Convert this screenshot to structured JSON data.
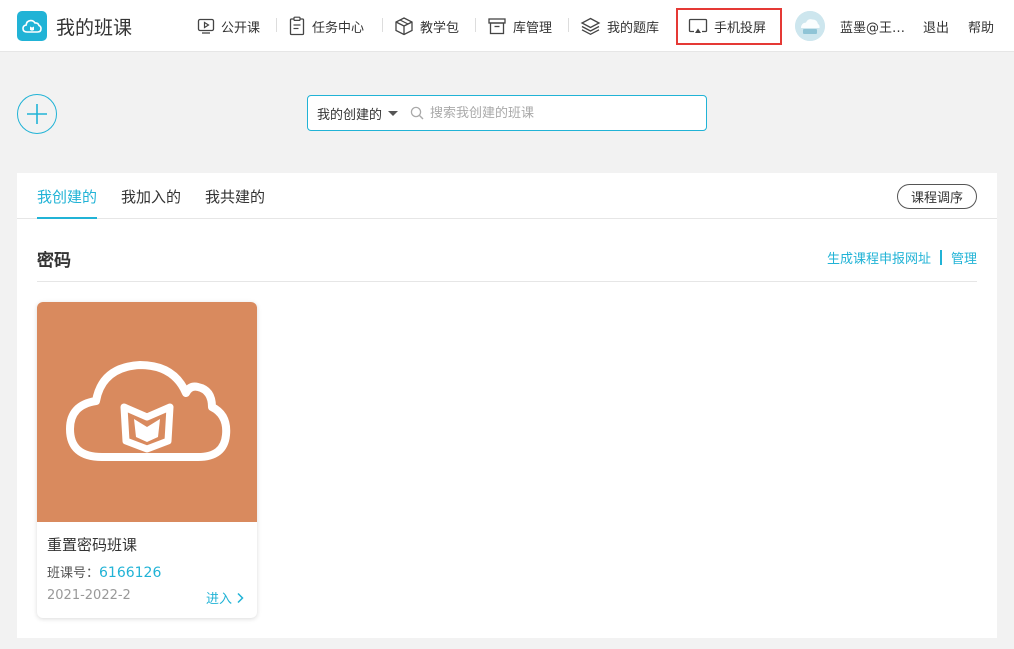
{
  "header": {
    "app_title": "我的班课",
    "nav": [
      {
        "label": "公开课",
        "icon": "video-play-icon"
      },
      {
        "label": "任务中心",
        "icon": "clipboard-icon"
      },
      {
        "label": "教学包",
        "icon": "package-box-icon"
      },
      {
        "label": "库管理",
        "icon": "archive-box-icon"
      },
      {
        "label": "我的题库",
        "icon": "layers-icon"
      },
      {
        "label": "手机投屏",
        "icon": "screen-cast-icon"
      }
    ],
    "user_name": "蓝墨@王…",
    "logout": "退出",
    "help": "帮助",
    "highlight_color": "#e53935"
  },
  "toolbar": {
    "add_icon": "plus-circle-icon",
    "scope_selected": "我的创建的",
    "search_placeholder": "搜索我创建的班课"
  },
  "tabs": {
    "items": [
      "我创建的",
      "我加入的",
      "我共建的"
    ],
    "active": "我创建的",
    "order_button": "课程调序"
  },
  "section": {
    "title": "密码",
    "generate_link": "生成课程申报网址",
    "manage_link": "管理"
  },
  "course": {
    "title": "重置密码班课",
    "code_label": "班课号：",
    "code": "6166126",
    "term": "2021-2022-2",
    "enter": "进入",
    "cover_color": "#d98a5e",
    "cover_icon": "cloud-book-icon"
  },
  "colors": {
    "accent": "#21b3d6",
    "background": "#f2f2f2"
  }
}
